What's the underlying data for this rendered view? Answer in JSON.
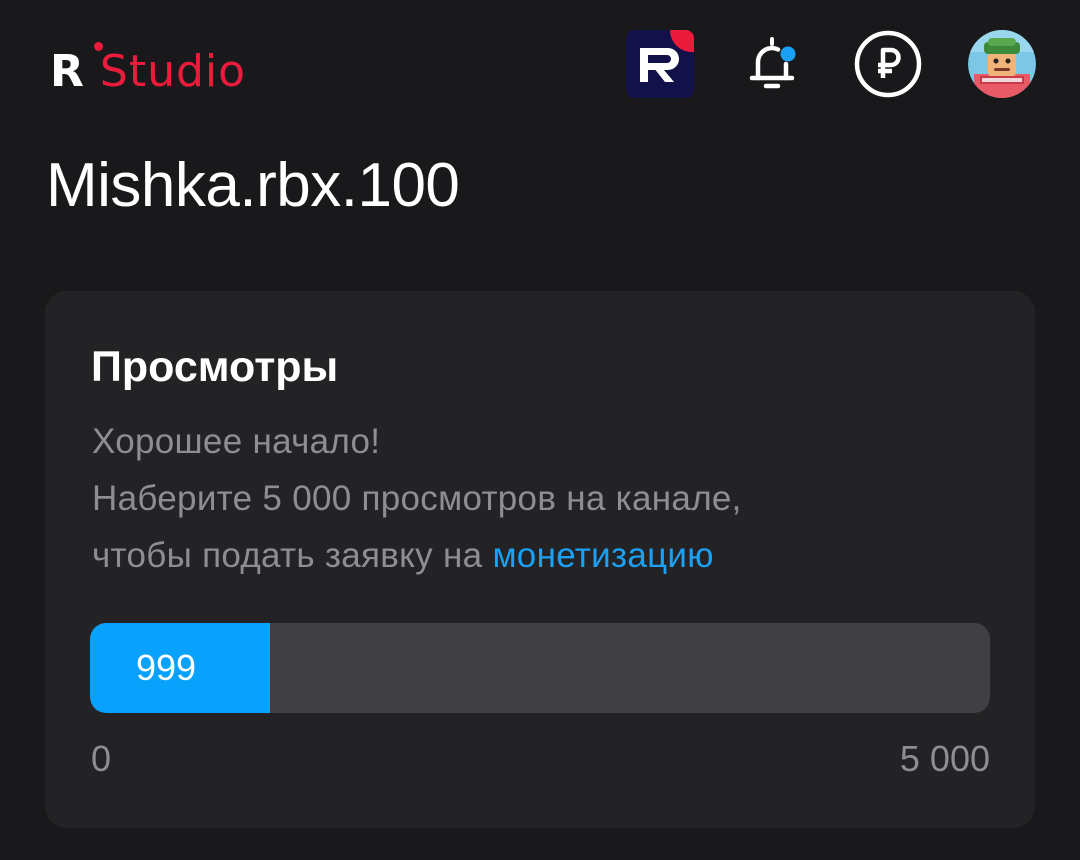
{
  "header": {
    "logo": {
      "letter": "R",
      "name": "Studio"
    },
    "icons": {
      "app": "rutube-app-icon",
      "notifications": "bell-icon",
      "wallet": "ruble-icon",
      "avatar": "avatar"
    },
    "notification_dot_color": "#1aa0f5"
  },
  "channel": {
    "title": "Mishka.rbx.100"
  },
  "views_card": {
    "title": "Просмотры",
    "line1": "Хорошее начало!",
    "line2": "Наберите 5 000 просмотров на канале,",
    "line3_prefix": "чтобы подать заявку на ",
    "line3_link": "монетизацию",
    "progress": {
      "current_label": "999",
      "current": 999,
      "goal": 5000,
      "min_label": "0",
      "max_label": "5 000",
      "fill_color": "#08a1fb"
    }
  },
  "colors": {
    "brand_red": "#ec1b3b",
    "accent_blue": "#1aa0f5",
    "background": "#19191b",
    "card": "#232325"
  }
}
